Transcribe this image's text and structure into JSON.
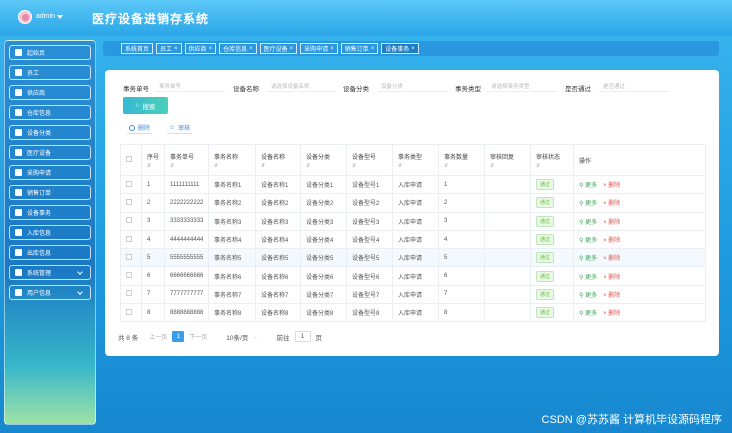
{
  "header": {
    "user": "admin",
    "title": "医疗设备进销存系统"
  },
  "sidebar": {
    "items": [
      {
        "label": "起始页",
        "icon": "home-icon"
      },
      {
        "label": "员工",
        "icon": "grid-icon"
      },
      {
        "label": "供应商",
        "icon": "grid-icon"
      },
      {
        "label": "仓库信息",
        "icon": "list-icon"
      },
      {
        "label": "设备分类",
        "icon": "grid-icon"
      },
      {
        "label": "医疗设备",
        "icon": "message-icon"
      },
      {
        "label": "采购申请",
        "icon": "list-icon"
      },
      {
        "label": "销售订单",
        "icon": "user-icon"
      },
      {
        "label": "设备事务",
        "icon": "chat-icon"
      },
      {
        "label": "入库信息",
        "icon": "message-icon"
      },
      {
        "label": "出库信息",
        "icon": "list-icon"
      },
      {
        "label": "系统管理",
        "icon": "grid-icon",
        "expandable": true
      },
      {
        "label": "用户信息",
        "icon": "card-icon",
        "expandable": true
      }
    ]
  },
  "tabs": [
    {
      "label": "系统首页",
      "closable": false
    },
    {
      "label": "员工",
      "closable": true
    },
    {
      "label": "供应商",
      "closable": true
    },
    {
      "label": "仓库信息",
      "closable": true
    },
    {
      "label": "医疗设备",
      "closable": true
    },
    {
      "label": "采购申请",
      "closable": true
    },
    {
      "label": "销售订单",
      "closable": true
    },
    {
      "label": "设备事务",
      "closable": true,
      "active": true
    }
  ],
  "filters": {
    "no_label": "事务单号",
    "no_placeholder": "事务单号",
    "name_label": "设备名称",
    "name_placeholder": "请选择设备名称",
    "cat_label": "设备分类",
    "cat_placeholder": "设备分类",
    "type_label": "事务类型",
    "type_placeholder": "请选择事务类型",
    "pass_label": "是否通过",
    "pass_placeholder": "是否通过",
    "search": "搜索",
    "delete": "删除",
    "audit": "审核"
  },
  "table": {
    "headers": [
      "序号",
      "事务单号",
      "事务名称",
      "设备名称",
      "设备分类",
      "设备型号",
      "事务类型",
      "事务数量",
      "审核回复",
      "审核状态",
      "操作"
    ],
    "more": "更多",
    "del": "删除",
    "rows": [
      [
        "1",
        "1111111111",
        "事务名称1",
        "设备名称1",
        "设备分类1",
        "设备型号1",
        "入库申请",
        "1",
        "",
        "通过"
      ],
      [
        "2",
        "2222222222",
        "事务名称2",
        "设备名称2",
        "设备分类2",
        "设备型号2",
        "入库申请",
        "2",
        "",
        "通过"
      ],
      [
        "3",
        "3333333333",
        "事务名称3",
        "设备名称3",
        "设备分类3",
        "设备型号3",
        "入库申请",
        "3",
        "",
        "通过"
      ],
      [
        "4",
        "4444444444",
        "事务名称4",
        "设备名称4",
        "设备分类4",
        "设备型号4",
        "入库申请",
        "4",
        "",
        "通过"
      ],
      [
        "5",
        "5555555555",
        "事务名称5",
        "设备名称5",
        "设备分类5",
        "设备型号5",
        "入库申请",
        "5",
        "",
        "通过"
      ],
      [
        "6",
        "6666666666",
        "事务名称6",
        "设备名称6",
        "设备分类6",
        "设备型号6",
        "入库申请",
        "6",
        "",
        "通过"
      ],
      [
        "7",
        "7777777777",
        "事务名称7",
        "设备名称7",
        "设备分类7",
        "设备型号7",
        "入库申请",
        "7",
        "",
        "通过"
      ],
      [
        "8",
        "8888888888",
        "事务名称8",
        "设备名称8",
        "设备分类8",
        "设备型号8",
        "入库申请",
        "8",
        "",
        "通过"
      ]
    ]
  },
  "pager": {
    "total": "共 8 条",
    "prev": "上一页",
    "page": "1",
    "next": "下一页",
    "size": "10条/页",
    "goto": "前往",
    "goto_value": "1",
    "unit": "页"
  },
  "watermark": "CSDN @苏苏酱 计算机毕设源码程序"
}
